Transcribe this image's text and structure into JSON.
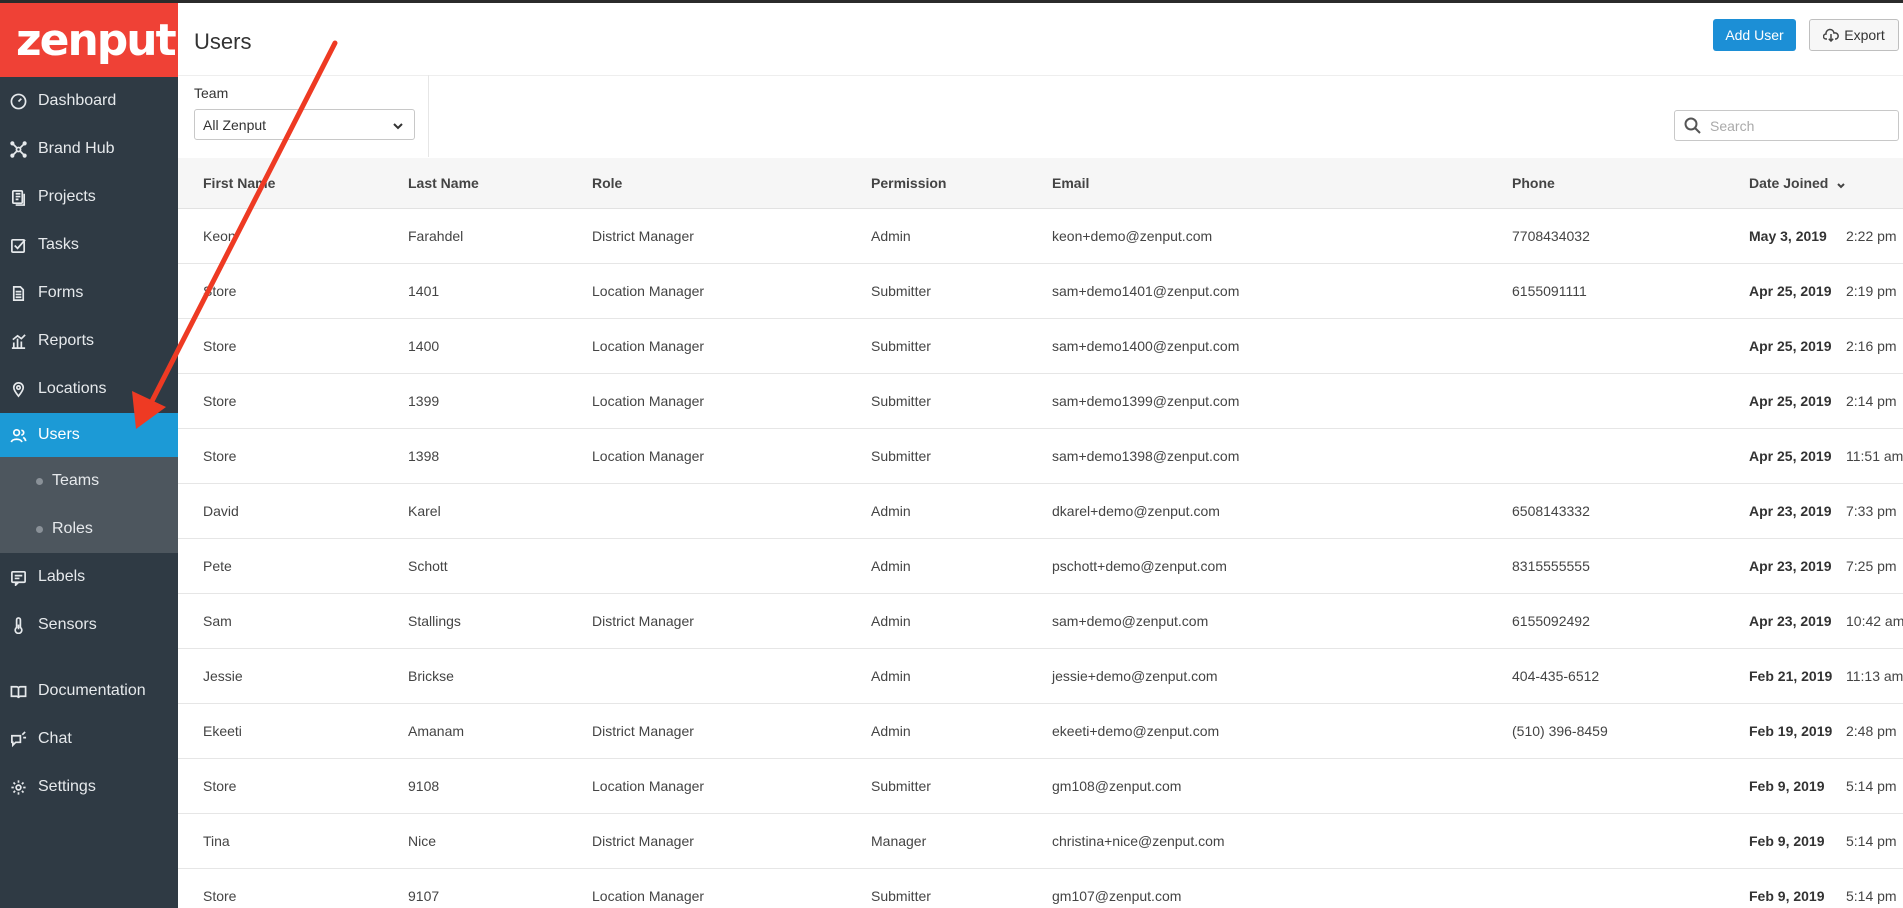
{
  "logo": {
    "text": "zenput."
  },
  "sidebar": {
    "items": [
      {
        "id": "dashboard",
        "label": "Dashboard",
        "icon": "gauge-icon"
      },
      {
        "id": "brand-hub",
        "label": "Brand Hub",
        "icon": "hub-icon"
      },
      {
        "id": "projects",
        "label": "Projects",
        "icon": "projects-icon"
      },
      {
        "id": "tasks",
        "label": "Tasks",
        "icon": "checkbox-icon"
      },
      {
        "id": "forms",
        "label": "Forms",
        "icon": "document-icon"
      },
      {
        "id": "reports",
        "label": "Reports",
        "icon": "bar-chart-icon"
      },
      {
        "id": "locations",
        "label": "Locations",
        "icon": "pin-icon"
      },
      {
        "id": "users",
        "label": "Users",
        "icon": "users-icon",
        "active": true
      }
    ],
    "subitems": [
      {
        "id": "teams",
        "label": "Teams"
      },
      {
        "id": "roles",
        "label": "Roles"
      }
    ],
    "items_after": [
      {
        "id": "labels",
        "label": "Labels",
        "icon": "label-icon"
      },
      {
        "id": "sensors",
        "label": "Sensors",
        "icon": "thermometer-icon"
      }
    ],
    "footer": [
      {
        "id": "documentation",
        "label": "Documentation",
        "icon": "book-icon"
      },
      {
        "id": "chat",
        "label": "Chat",
        "icon": "chat-icon"
      },
      {
        "id": "settings",
        "label": "Settings",
        "icon": "gear-icon"
      }
    ]
  },
  "header": {
    "title": "Users",
    "add_user_label": "Add User",
    "export_label": "Export"
  },
  "filter": {
    "team_label": "Team",
    "team_value": "All Zenput"
  },
  "search": {
    "placeholder": "Search"
  },
  "table": {
    "columns": [
      "First Name",
      "Last Name",
      "Role",
      "Permission",
      "Email",
      "Phone",
      "Date Joined"
    ],
    "rows": [
      {
        "first": "Keon",
        "last": "Farahdel",
        "role": "District Manager",
        "permission": "Admin",
        "email": "keon+demo@zenput.com",
        "phone": "7708434032",
        "date": "May 3, 2019",
        "time": "2:22 pm"
      },
      {
        "first": "Store",
        "last": "1401",
        "role": "Location Manager",
        "permission": "Submitter",
        "email": "sam+demo1401@zenput.com",
        "phone": "6155091111",
        "date": "Apr 25, 2019",
        "time": "2:19 pm"
      },
      {
        "first": "Store",
        "last": "1400",
        "role": "Location Manager",
        "permission": "Submitter",
        "email": "sam+demo1400@zenput.com",
        "phone": "",
        "date": "Apr 25, 2019",
        "time": "2:16 pm"
      },
      {
        "first": "Store",
        "last": "1399",
        "role": "Location Manager",
        "permission": "Submitter",
        "email": "sam+demo1399@zenput.com",
        "phone": "",
        "date": "Apr 25, 2019",
        "time": "2:14 pm"
      },
      {
        "first": "Store",
        "last": "1398",
        "role": "Location Manager",
        "permission": "Submitter",
        "email": "sam+demo1398@zenput.com",
        "phone": "",
        "date": "Apr 25, 2019",
        "time": "11:51 am"
      },
      {
        "first": "David",
        "last": "Karel",
        "role": "",
        "permission": "Admin",
        "email": "dkarel+demo@zenput.com",
        "phone": "6508143332",
        "date": "Apr 23, 2019",
        "time": "7:33 pm"
      },
      {
        "first": "Pete",
        "last": "Schott",
        "role": "",
        "permission": "Admin",
        "email": "pschott+demo@zenput.com",
        "phone": "8315555555",
        "date": "Apr 23, 2019",
        "time": "7:25 pm"
      },
      {
        "first": "Sam",
        "last": "Stallings",
        "role": "District Manager",
        "permission": "Admin",
        "email": "sam+demo@zenput.com",
        "phone": "6155092492",
        "date": "Apr 23, 2019",
        "time": "10:42 am"
      },
      {
        "first": "Jessie",
        "last": "Brickse",
        "role": "",
        "permission": "Admin",
        "email": "jessie+demo@zenput.com",
        "phone": "404-435-6512",
        "date": "Feb 21, 2019",
        "time": "11:13 am"
      },
      {
        "first": "Ekeeti",
        "last": "Amanam",
        "role": "District Manager",
        "permission": "Admin",
        "email": "ekeeti+demo@zenput.com",
        "phone": "(510) 396-8459",
        "date": "Feb 19, 2019",
        "time": "2:48 pm"
      },
      {
        "first": "Store",
        "last": "9108",
        "role": "Location Manager",
        "permission": "Submitter",
        "email": "gm108@zenput.com",
        "phone": "",
        "date": "Feb 9, 2019",
        "time": "5:14 pm"
      },
      {
        "first": "Tina",
        "last": "Nice",
        "role": "District Manager",
        "permission": "Manager",
        "email": "christina+nice@zenput.com",
        "phone": "",
        "date": "Feb 9, 2019",
        "time": "5:14 pm"
      },
      {
        "first": "Store",
        "last": "9107",
        "role": "Location Manager",
        "permission": "Submitter",
        "email": "gm107@zenput.com",
        "phone": "",
        "date": "Feb 9, 2019",
        "time": "5:14 pm"
      }
    ]
  },
  "colors": {
    "sidebar_bg": "#2f3a44",
    "logo_bg": "#ef4136",
    "active_bg": "#1c9ad6",
    "primary_button": "#1c8fd6",
    "annotation_arrow": "#ee3a23"
  }
}
